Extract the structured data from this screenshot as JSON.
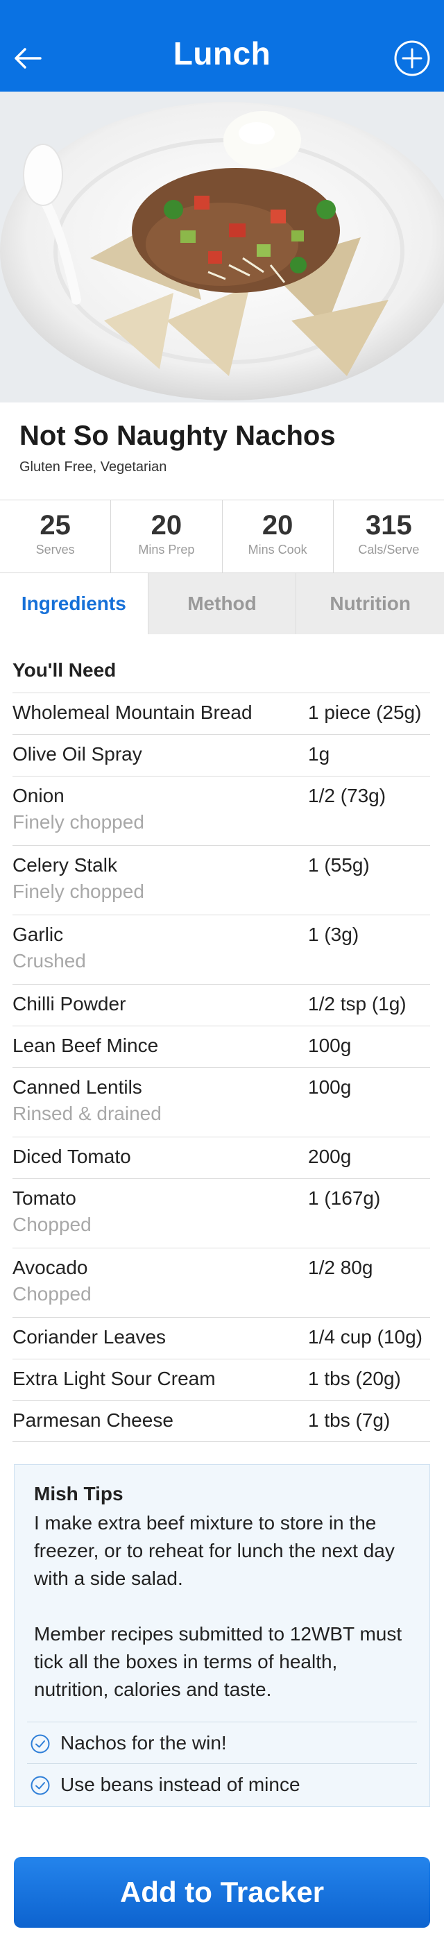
{
  "header": {
    "title": "Lunch"
  },
  "recipe": {
    "title": "Not So Naughty Nachos",
    "tags": "Gluten Free, Vegetarian"
  },
  "stats": [
    {
      "value": "25",
      "label": "Serves"
    },
    {
      "value": "20",
      "label": "Mins Prep"
    },
    {
      "value": "20",
      "label": "Mins Cook"
    },
    {
      "value": "315",
      "label": "Cals/Serve"
    }
  ],
  "tabs": [
    {
      "label": "Ingredients"
    },
    {
      "label": "Method"
    },
    {
      "label": "Nutrition"
    }
  ],
  "ingredients": {
    "heading": "You'll Need",
    "items": [
      {
        "name": "Wholemeal Mountain Bread",
        "note": "",
        "qty": "1 piece (25g)"
      },
      {
        "name": "Olive Oil Spray",
        "note": "",
        "qty": "1g"
      },
      {
        "name": "Onion",
        "note": "Finely chopped",
        "qty": "1/2 (73g)"
      },
      {
        "name": "Celery Stalk",
        "note": "Finely chopped",
        "qty": "1 (55g)"
      },
      {
        "name": "Garlic",
        "note": "Crushed",
        "qty": "1 (3g)"
      },
      {
        "name": "Chilli Powder",
        "note": "",
        "qty": "1/2 tsp (1g)"
      },
      {
        "name": "Lean Beef Mince",
        "note": "",
        "qty": "100g"
      },
      {
        "name": "Canned Lentils",
        "note": "Rinsed & drained",
        "qty": "100g"
      },
      {
        "name": "Diced Tomato",
        "note": "",
        "qty": "200g"
      },
      {
        "name": "Tomato",
        "note": "Chopped",
        "qty": "1 (167g)"
      },
      {
        "name": "Avocado",
        "note": "Chopped",
        "qty": "1/2 80g"
      },
      {
        "name": "Coriander Leaves",
        "note": "",
        "qty": "1/4 cup (10g)"
      },
      {
        "name": "Extra Light Sour Cream",
        "note": "",
        "qty": "1 tbs (20g)"
      },
      {
        "name": "Parmesan Cheese",
        "note": "",
        "qty": "1 tbs (7g)"
      }
    ]
  },
  "tips": {
    "title": "Mish Tips",
    "paragraph1": "I make extra beef mixture to store in the freezer, or to reheat for lunch the next day with a side salad.",
    "paragraph2": "Member recipes submitted to 12WBT must tick all the boxes in terms of health, nutrition, calories and taste.",
    "checklist": [
      "Nachos for the win!",
      "Use beans instead of mince"
    ]
  },
  "cta": {
    "label": "Add to Tracker"
  },
  "colors": {
    "accent": "#0a72e3",
    "active_tab": "#1670d8",
    "muted": "#a8a8a8"
  }
}
